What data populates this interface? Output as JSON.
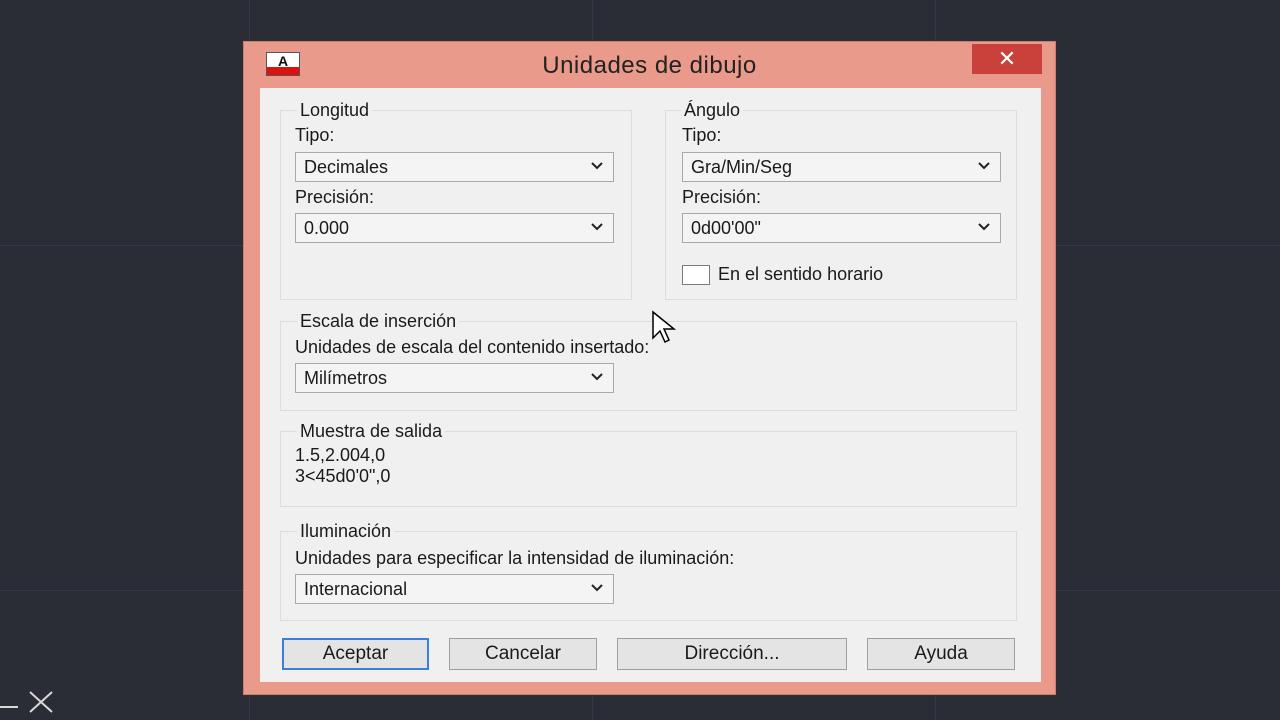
{
  "dialog": {
    "title": "Unidades de dibujo",
    "app_icon": "autocad-icon",
    "close_label": "✕"
  },
  "longitud": {
    "legend": "Longitud",
    "tipo_label": "Tipo:",
    "tipo_value": "Decimales",
    "precision_label": "Precisión:",
    "precision_value": "0.000"
  },
  "angulo": {
    "legend": "Ángulo",
    "tipo_label": "Tipo:",
    "tipo_value": "Gra/Min/Seg",
    "precision_label": "Precisión:",
    "precision_value": "0d00'00\"",
    "clockwise_label": "En el sentido horario",
    "clockwise_checked": false
  },
  "escala": {
    "legend": "Escala de inserción",
    "label": "Unidades de escala del contenido insertado:",
    "value": "Milímetros"
  },
  "muestra": {
    "legend": "Muestra de salida",
    "line1": "1.5,2.004,0",
    "line2": "3<45d0'0\",0"
  },
  "iluminacion": {
    "legend": "Iluminación",
    "label": "Unidades para especificar la intensidad de iluminación:",
    "value": "Internacional"
  },
  "buttons": {
    "ok": "Aceptar",
    "cancel": "Cancelar",
    "direction": "Dirección...",
    "help": "Ayuda"
  },
  "colors": {
    "frame": "#e99a8a",
    "close": "#c9413a",
    "background": "#2a2d36",
    "default_button_border": "#3c7fd9"
  }
}
